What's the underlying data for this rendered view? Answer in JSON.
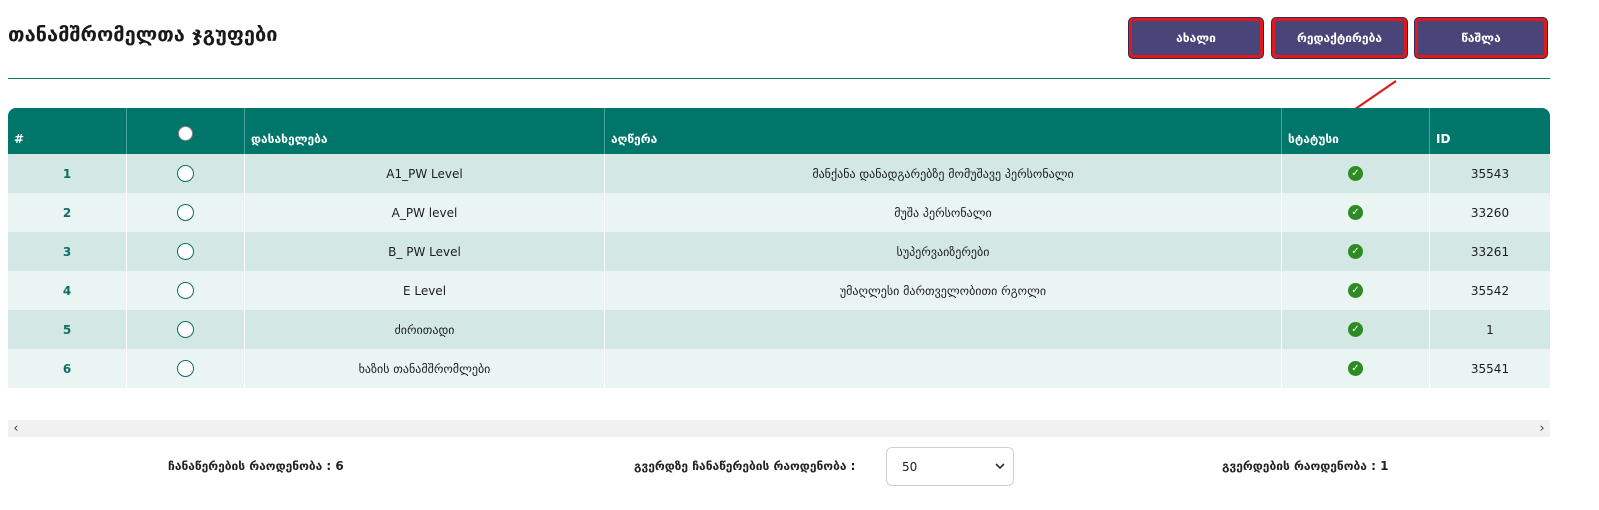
{
  "page": {
    "title": "თანამშრომელთა ჯგუფები"
  },
  "toolbar": {
    "new_label": "ახალი",
    "edit_label": "რედაქტირება",
    "delete_label": "წაშლა"
  },
  "table": {
    "headers": {
      "num": "#",
      "name": "დასახელება",
      "description": "აღწერა",
      "status": "სტატუსი",
      "id": "ID"
    },
    "rows": [
      {
        "num": "1",
        "name": "A1_PW Level",
        "description": "მანქანა დანადგარებზე მომუშავე პერსონალი",
        "status": "active",
        "id": "35543"
      },
      {
        "num": "2",
        "name": "A_PW level",
        "description": "მუშა პერსონალი",
        "status": "active",
        "id": "33260"
      },
      {
        "num": "3",
        "name": "B_ PW Level",
        "description": "სუპერვაიზერები",
        "status": "active",
        "id": "33261"
      },
      {
        "num": "4",
        "name": "E Level",
        "description": "უმაღლესი მართველობითი რგოლი",
        "status": "active",
        "id": "35542"
      },
      {
        "num": "5",
        "name": "ძირითადი",
        "description": "",
        "status": "active",
        "id": "1"
      },
      {
        "num": "6",
        "name": "ხაზის თანამშრომლები",
        "description": "",
        "status": "active",
        "id": "35541"
      }
    ]
  },
  "footer": {
    "records_count": "ჩანაწერების რაოდენობა : 6",
    "per_page_label": "გვერდზე ჩანაწერების რაოდენობა :",
    "per_page_value": "50",
    "pages_count": "გვერდების რაოდენობა : 1"
  },
  "colors": {
    "header_bg": "#00756a",
    "button_bg": "#4a4578",
    "highlight": "#e01a1a",
    "status_ok": "#2e8b24"
  },
  "icons": {
    "status": "check-circle-icon",
    "scroll_left": "chevron-left-icon",
    "scroll_right": "chevron-right-icon",
    "select": "chevron-down-icon"
  }
}
